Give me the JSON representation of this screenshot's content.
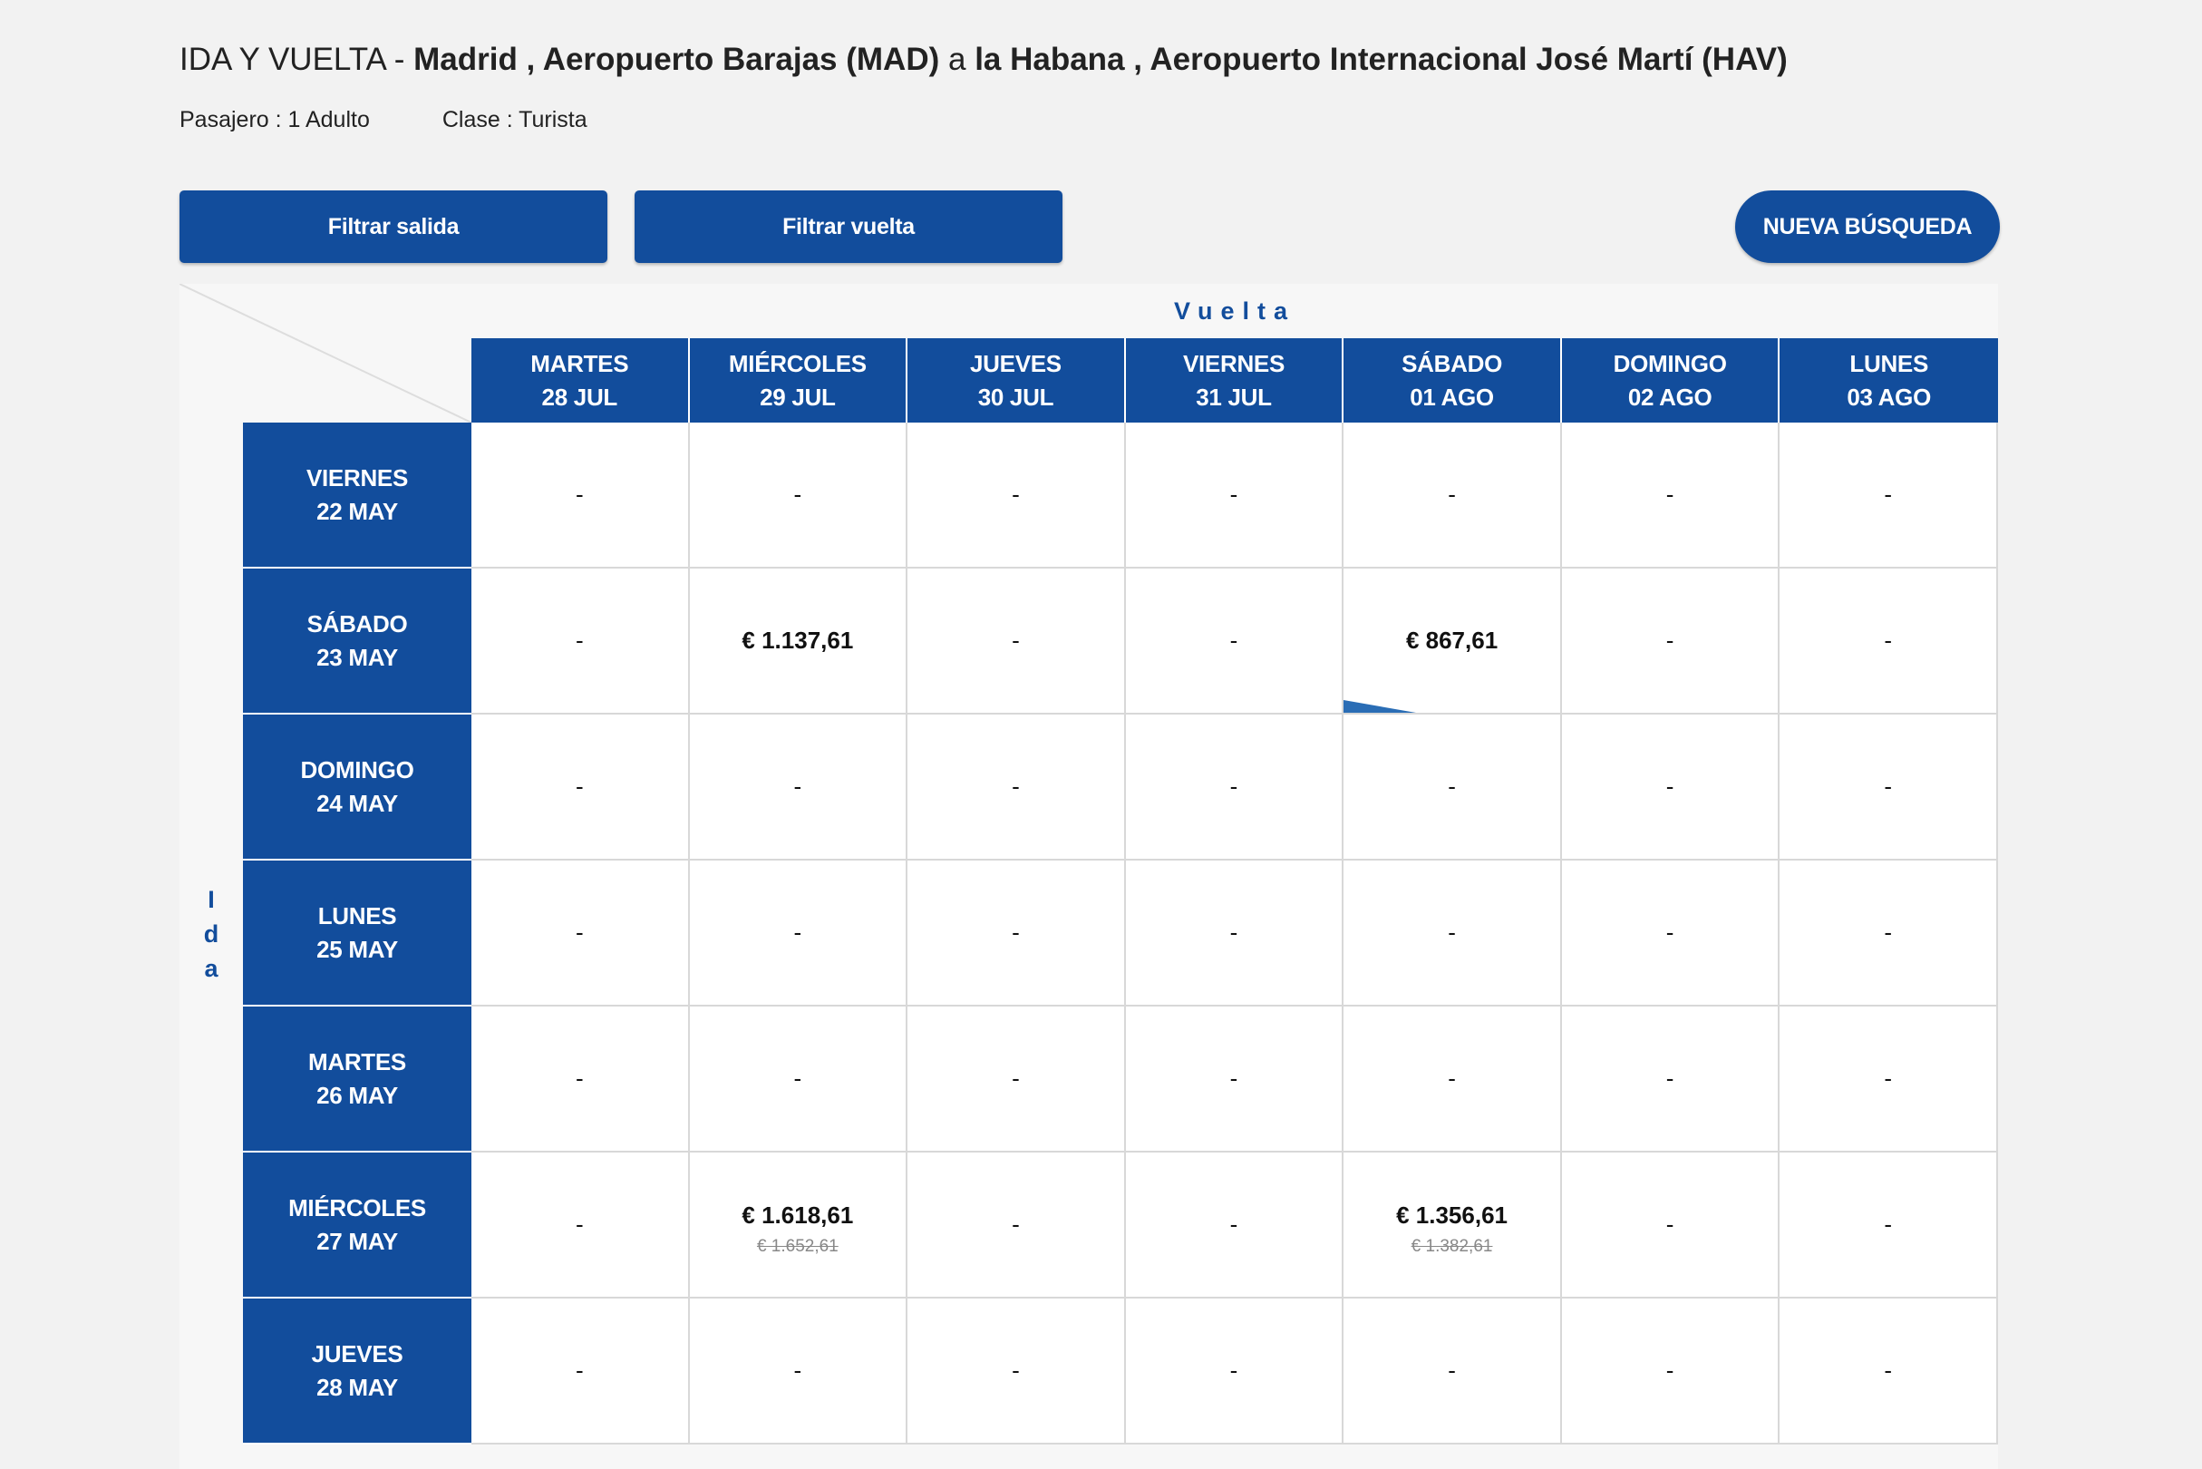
{
  "header": {
    "trip_type": "IDA Y VUELTA",
    "dash": " - ",
    "origin": "Madrid , Aeropuerto Barajas (MAD)",
    "connector": " a ",
    "destination": "la Habana , Aeropuerto Internacional José Martí (HAV)",
    "passengers": "Pasajero : 1 Adulto",
    "class": "Clase : Turista"
  },
  "buttons": {
    "filter_departure": "Filtrar salida",
    "filter_return": "Filtrar vuelta",
    "new_search": "NUEVA BÚSQUEDA"
  },
  "matrix": {
    "return_label": "Vuelta",
    "departure_label": [
      "I",
      "d",
      "a"
    ],
    "return_dates": [
      {
        "day": "MARTES",
        "date": "28 JUL"
      },
      {
        "day": "MIÉRCOLES",
        "date": "29 JUL"
      },
      {
        "day": "JUEVES",
        "date": "30 JUL"
      },
      {
        "day": "VIERNES",
        "date": "31 JUL"
      },
      {
        "day": "SÁBADO",
        "date": "01 AGO"
      },
      {
        "day": "DOMINGO",
        "date": "02 AGO"
      },
      {
        "day": "LUNES",
        "date": "03 AGO"
      }
    ],
    "rows": [
      {
        "day": "VIERNES",
        "date": "22 MAY",
        "cells": [
          {
            "price": "-"
          },
          {
            "price": "-"
          },
          {
            "price": "-"
          },
          {
            "price": "-"
          },
          {
            "price": "-"
          },
          {
            "price": "-"
          },
          {
            "price": "-"
          }
        ]
      },
      {
        "day": "SÁBADO",
        "date": "23 MAY",
        "cells": [
          {
            "price": "-"
          },
          {
            "price": "€ 1.137,61"
          },
          {
            "price": "-"
          },
          {
            "price": "-"
          },
          {
            "price": "€ 867,61",
            "selected": true
          },
          {
            "price": "-"
          },
          {
            "price": "-"
          }
        ]
      },
      {
        "day": "DOMINGO",
        "date": "24 MAY",
        "cells": [
          {
            "price": "-"
          },
          {
            "price": "-"
          },
          {
            "price": "-"
          },
          {
            "price": "-"
          },
          {
            "price": "-"
          },
          {
            "price": "-"
          },
          {
            "price": "-"
          }
        ]
      },
      {
        "day": "LUNES",
        "date": "25 MAY",
        "cells": [
          {
            "price": "-"
          },
          {
            "price": "-"
          },
          {
            "price": "-"
          },
          {
            "price": "-"
          },
          {
            "price": "-"
          },
          {
            "price": "-"
          },
          {
            "price": "-"
          }
        ]
      },
      {
        "day": "MARTES",
        "date": "26 MAY",
        "cells": [
          {
            "price": "-"
          },
          {
            "price": "-"
          },
          {
            "price": "-"
          },
          {
            "price": "-"
          },
          {
            "price": "-"
          },
          {
            "price": "-"
          },
          {
            "price": "-"
          }
        ]
      },
      {
        "day": "MIÉRCOLES",
        "date": "27 MAY",
        "cells": [
          {
            "price": "-"
          },
          {
            "price": "€ 1.618,61",
            "old_price": "€ 1.652,61"
          },
          {
            "price": "-"
          },
          {
            "price": "-"
          },
          {
            "price": "€ 1.356,61",
            "old_price": "€ 1.382,61"
          },
          {
            "price": "-"
          },
          {
            "price": "-"
          }
        ]
      },
      {
        "day": "JUEVES",
        "date": "28 MAY",
        "cells": [
          {
            "price": "-"
          },
          {
            "price": "-"
          },
          {
            "price": "-"
          },
          {
            "price": "-"
          },
          {
            "price": "-"
          },
          {
            "price": "-"
          },
          {
            "price": "-"
          }
        ]
      }
    ]
  },
  "colors": {
    "primary": "#124d9c",
    "marker": "#2a6db5",
    "background": "#f2f2f2"
  }
}
